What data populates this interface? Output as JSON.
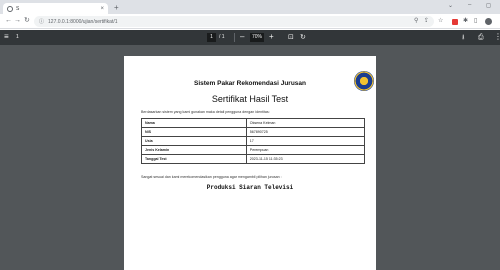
{
  "browser": {
    "tab_title": "S",
    "tab_close": "×",
    "new_tab": "+",
    "url": "127.0.0.1:8000/ujian/sertifikat/1",
    "window_controls": [
      "⌄",
      "–",
      "◻"
    ]
  },
  "viewer": {
    "file_name": "1",
    "current_page": "1",
    "page_total": "/ 1",
    "zoom": "70%"
  },
  "document": {
    "header": "Sistem Pakar Rekomendasi Jurusan",
    "subtitle": "Sertifikat Hasil Test",
    "intro": "Berdasarkan sistem yang kami gunakan maka detail pengguna dengan identitas:",
    "rows": [
      {
        "label": "Nama",
        "value": "Oksena Kelman"
      },
      {
        "label": "NIS",
        "value": "567890725"
      },
      {
        "label": "Usia",
        "value": "17"
      },
      {
        "label": "Jenis Kelamin",
        "value": "Perempuan"
      },
      {
        "label": "Tanggal Test",
        "value": "2023-11-15 11:35:23"
      }
    ],
    "outro": "Sangat sesuai dan kami merekomendasikan pengguna agar mengambil pilihan jurusan :",
    "result": "Produksi Siaran Televisi"
  },
  "icons": {
    "menu": "≡",
    "zoom_out": "–",
    "zoom_in": "+",
    "fit": "⊡",
    "rotate": "↻",
    "download": "⭳",
    "print": "⎙",
    "more": "⋮"
  }
}
